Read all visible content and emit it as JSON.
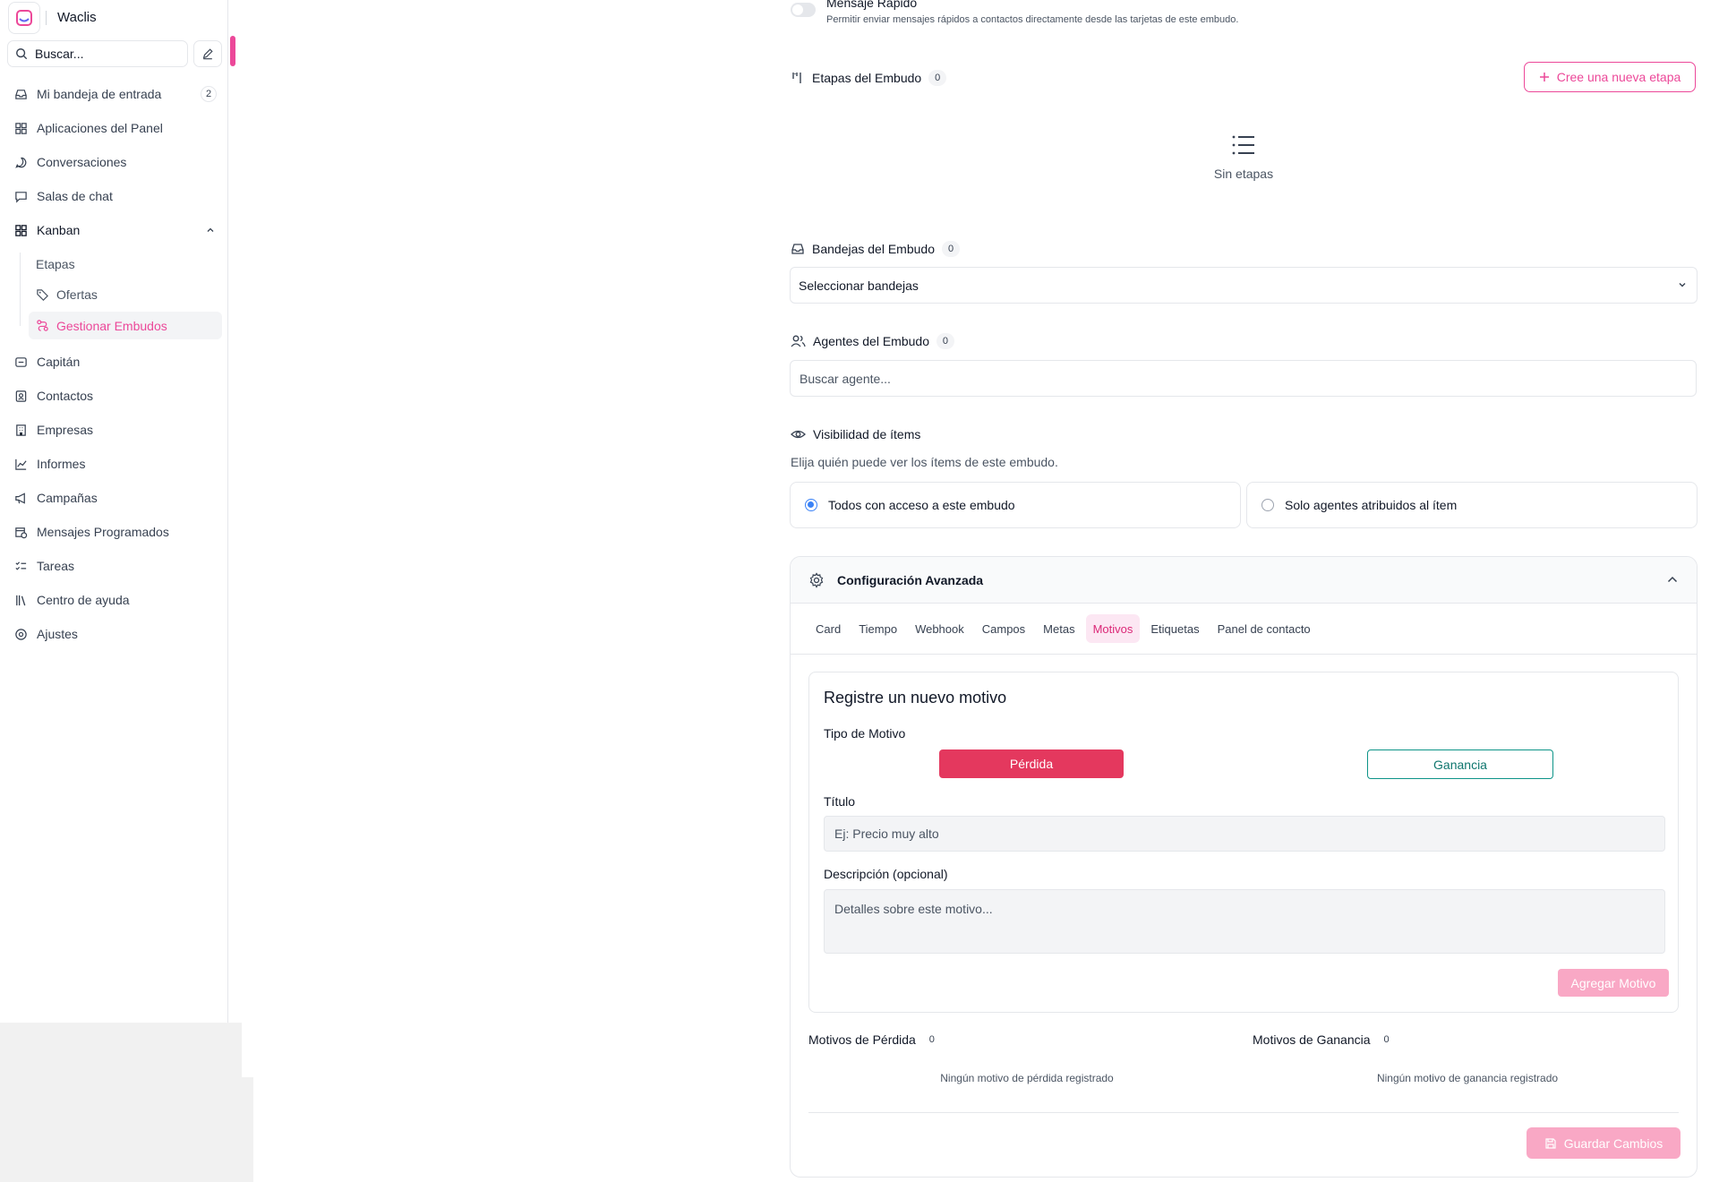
{
  "app": {
    "name": "Waclis"
  },
  "sidebar": {
    "search_placeholder": "Buscar...",
    "items": [
      {
        "label": "Mi bandeja de entrada",
        "icon": "inbox-icon",
        "badge": "2"
      },
      {
        "label": "Aplicaciones del Panel",
        "icon": "apps-grid-icon"
      },
      {
        "label": "Conversaciones",
        "icon": "chat-bubble-icon"
      },
      {
        "label": "Salas de chat",
        "icon": "chat-square-icon"
      },
      {
        "label": "Kanban",
        "icon": "kanban-grid-icon",
        "expanded": true
      },
      {
        "label": "Capitán",
        "icon": "captain-icon"
      },
      {
        "label": "Contactos",
        "icon": "contacts-icon"
      },
      {
        "label": "Empresas",
        "icon": "building-icon"
      },
      {
        "label": "Informes",
        "icon": "chart-line-icon"
      },
      {
        "label": "Campañas",
        "icon": "megaphone-icon"
      },
      {
        "label": "Mensajes Programados",
        "icon": "calendar-clock-icon"
      },
      {
        "label": "Tareas",
        "icon": "tasks-icon"
      },
      {
        "label": "Centro de ayuda",
        "icon": "library-icon"
      },
      {
        "label": "Ajustes",
        "icon": "settings-icon"
      }
    ],
    "kanban_sub": [
      {
        "label": "Etapas"
      },
      {
        "label": "Ofertas",
        "icon": "tags-icon"
      },
      {
        "label": "Gestionar Embudos",
        "icon": "funnel-route-icon",
        "active": true
      }
    ]
  },
  "main": {
    "quick_message": {
      "title": "Mensaje Rápido",
      "description": "Permitir enviar mensajes rápidos a contactos directamente desde las tarjetas de este embudo.",
      "enabled": false
    },
    "stages": {
      "title": "Etapas del Embudo",
      "count": "0",
      "new_button": "Cree una nueva etapa",
      "empty_text": "Sin etapas"
    },
    "inboxes": {
      "title": "Bandejas del Embudo",
      "count": "0",
      "select_value": "Seleccionar bandejas"
    },
    "agents": {
      "title": "Agentes del Embudo",
      "count": "0",
      "search_placeholder": "Buscar agente..."
    },
    "visibility": {
      "title": "Visibilidad de ítems",
      "description": "Elija quién puede ver los ítems de este embudo.",
      "options": [
        {
          "label": "Todos con acceso a este embudo",
          "selected": true
        },
        {
          "label": "Solo agentes atribuidos al ítem",
          "selected": false
        }
      ]
    },
    "advanced": {
      "title": "Configuración Avanzada",
      "tabs": [
        "Card",
        "Tiempo",
        "Webhook",
        "Campos",
        "Metas",
        "Motivos",
        "Etiquetas",
        "Panel de contacto"
      ],
      "active_tab": "Motivos",
      "new_reason": {
        "title": "Registre un nuevo motivo",
        "type_label": "Tipo de Motivo",
        "loss_button": "Pérdida",
        "gain_button": "Ganancia",
        "title_label": "Título",
        "title_placeholder": "Ej: Precio muy alto",
        "description_label": "Descripción (opcional)",
        "description_placeholder": "Detalles sobre este motivo...",
        "add_button": "Agregar Motivo"
      },
      "loss_reasons": {
        "title": "Motivos de Pérdida",
        "count": "0",
        "empty": "Ningún motivo de pérdida registrado"
      },
      "gain_reasons": {
        "title": "Motivos de Ganancia",
        "count": "0",
        "empty": "Ningún motivo de ganancia registrado"
      },
      "save_button": "Guardar Cambios"
    }
  },
  "colors": {
    "accent": "#ec4899",
    "loss": "#e11d48",
    "gain": "#0d9488",
    "selected_radio": "#3b82f6"
  }
}
